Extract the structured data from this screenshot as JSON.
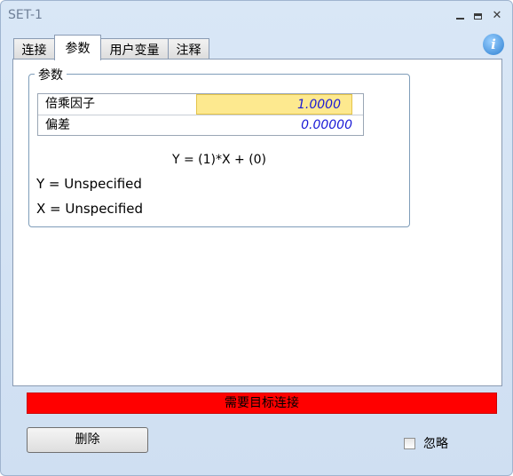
{
  "window": {
    "title": "SET-1"
  },
  "tabs": [
    {
      "label": "连接"
    },
    {
      "label": "参数",
      "active": true
    },
    {
      "label": "用户变量"
    },
    {
      "label": "注释"
    }
  ],
  "params": {
    "group_label": "参数",
    "rows": [
      {
        "label": "倍乘因子",
        "value": "1.0000"
      },
      {
        "label": "偏差",
        "value": "0.00000"
      }
    ],
    "formula": "Y = (1)*X + (0)",
    "y_line": "Y = Unspecified",
    "x_line": "X = Unspecified"
  },
  "status": {
    "text": "需要目标连接",
    "color": "#ff0000"
  },
  "buttons": {
    "delete": "删除"
  },
  "ignore": {
    "label": "忽略",
    "checked": false
  },
  "icons": {
    "info": "info-icon"
  }
}
